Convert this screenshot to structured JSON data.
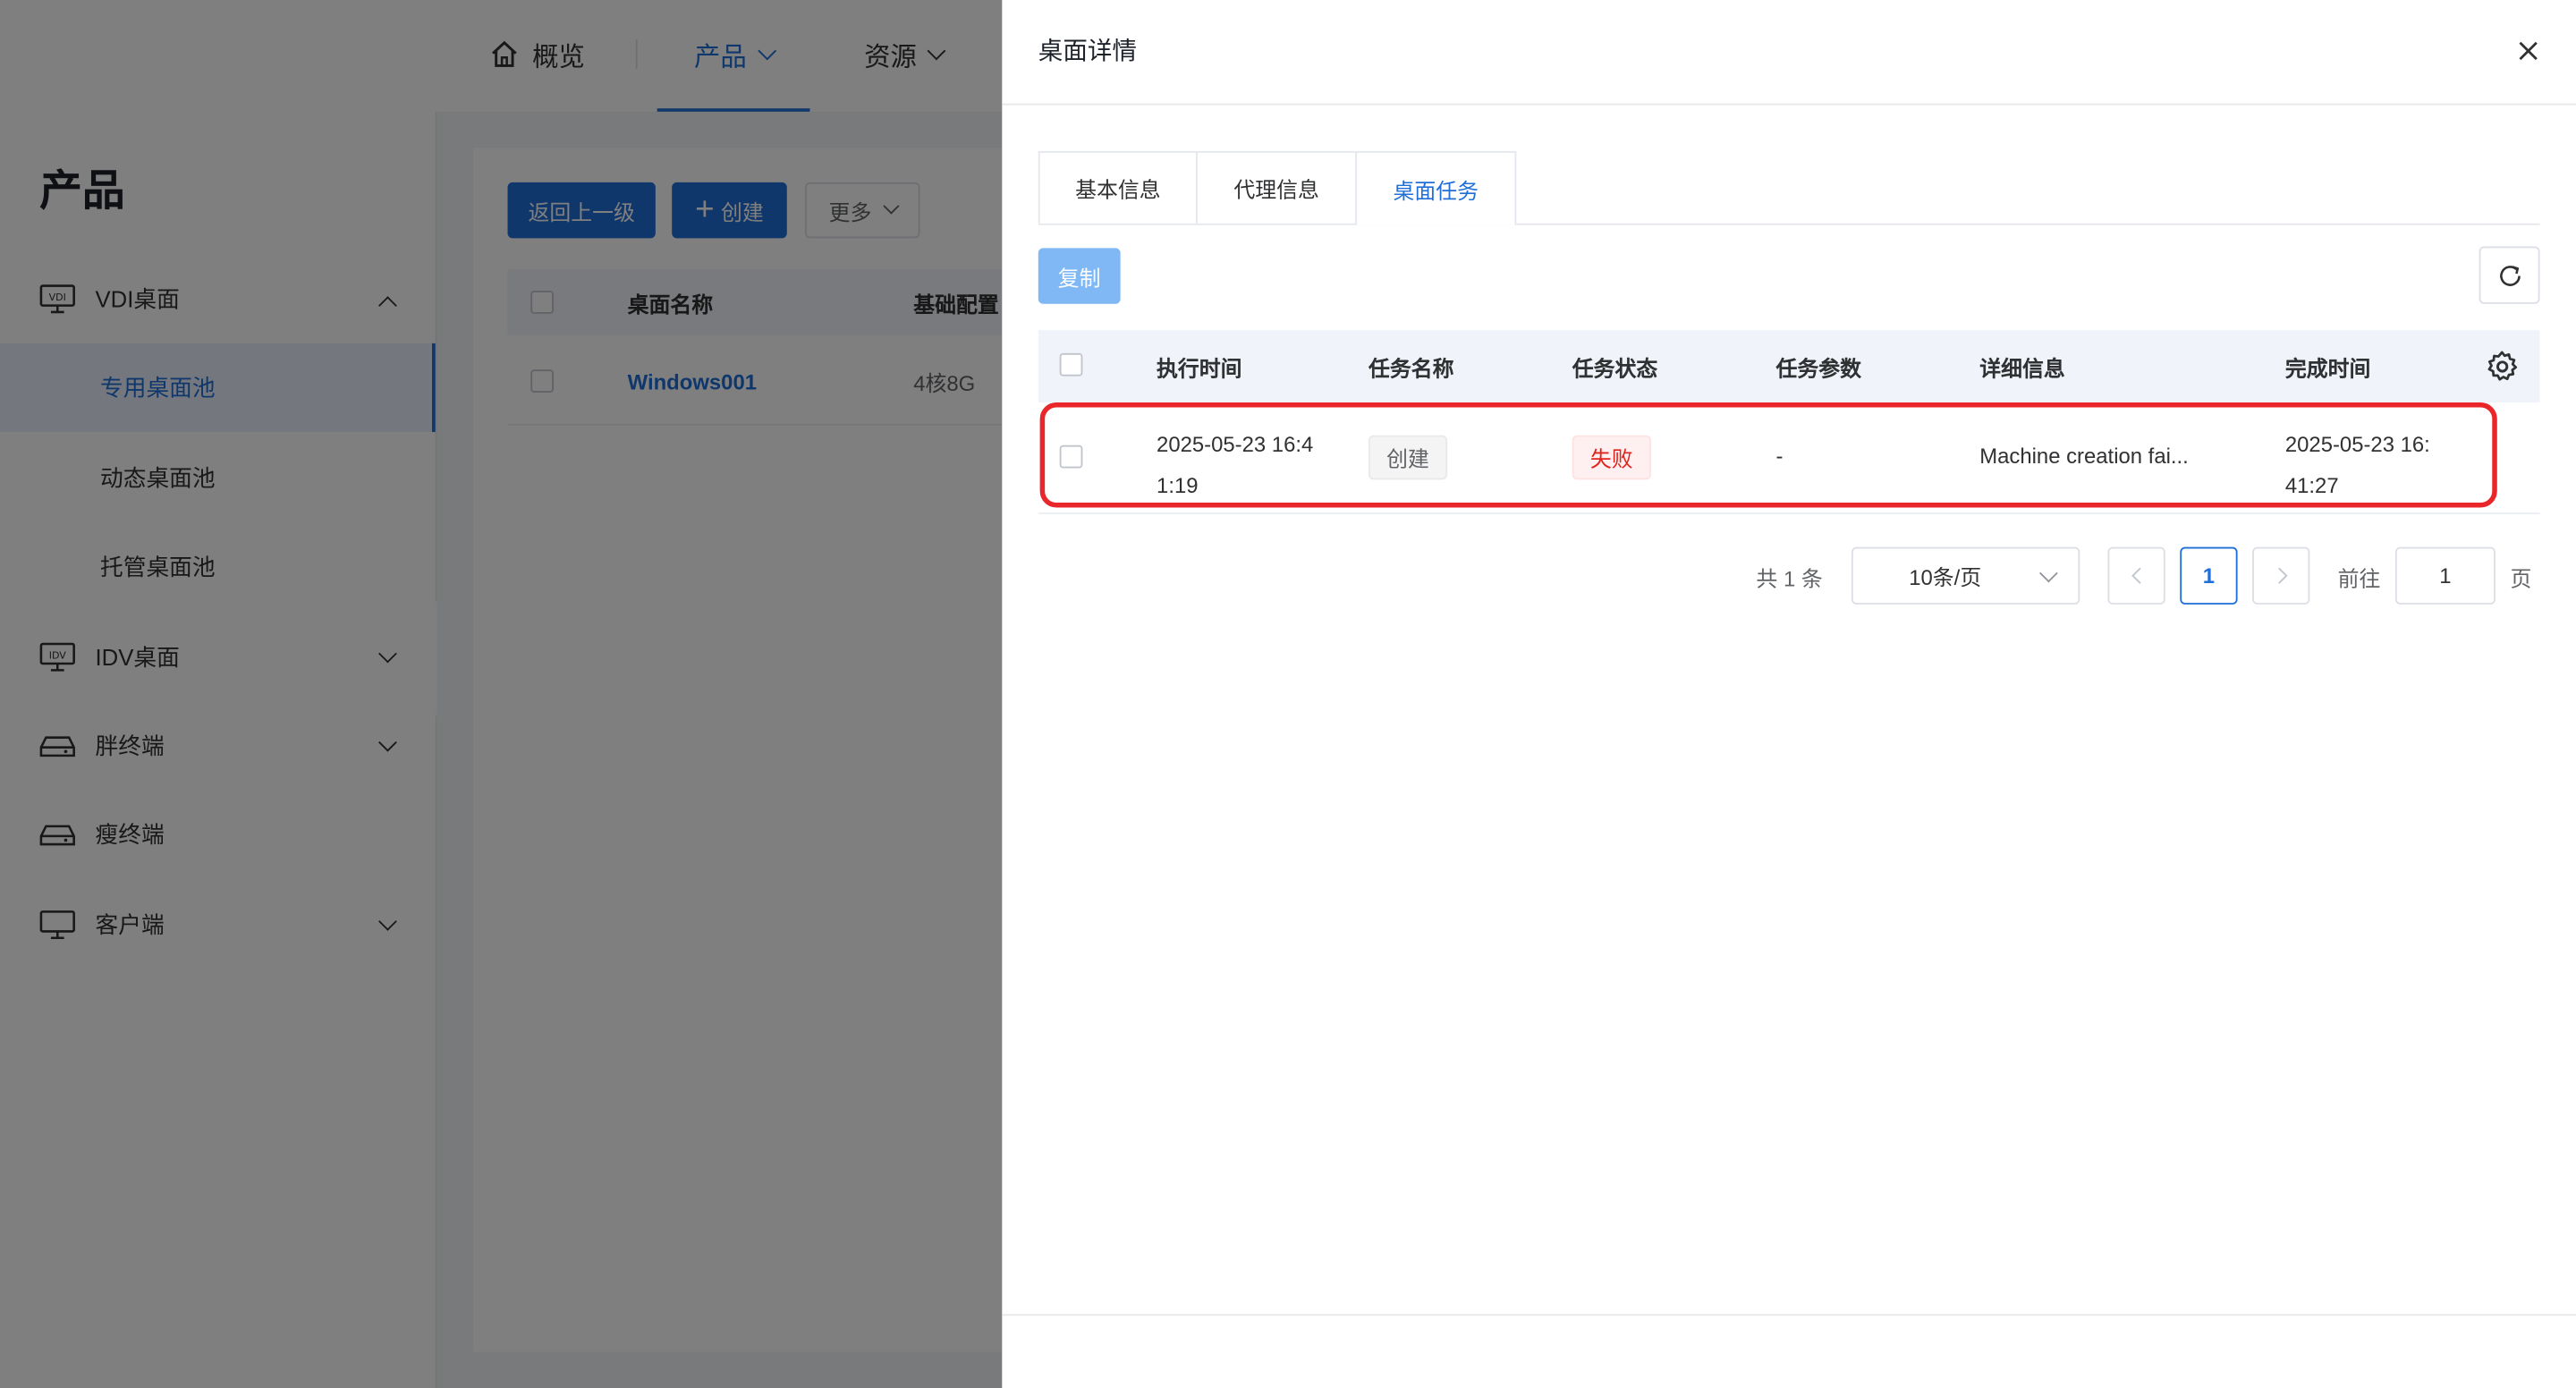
{
  "topnav": {
    "items": [
      {
        "label": "概览",
        "icon": "home-icon"
      },
      {
        "label": "产品",
        "active": true
      },
      {
        "label": "资源"
      }
    ]
  },
  "sidebar": {
    "title": "产品",
    "groups": [
      {
        "label": "VDI桌面",
        "icon": "vdi-monitor-icon",
        "expanded": true,
        "items": [
          {
            "label": "专用桌面池",
            "active": true
          },
          {
            "label": "动态桌面池"
          },
          {
            "label": "托管桌面池"
          }
        ]
      },
      {
        "label": "IDV桌面",
        "icon": "idv-monitor-icon"
      },
      {
        "label": "胖终端",
        "icon": "fat-terminal-icon"
      },
      {
        "label": "瘦终端",
        "icon": "thin-terminal-icon"
      },
      {
        "label": "客户端",
        "icon": "client-monitor-icon"
      }
    ]
  },
  "main": {
    "buttons": {
      "back": "返回上一级",
      "create": "创建",
      "more": "更多"
    },
    "columns": [
      "桌面名称",
      "基础配置"
    ],
    "rows": [
      {
        "name": "Windows001",
        "config": "4核8G"
      }
    ]
  },
  "drawer": {
    "title": "桌面详情",
    "tabs": [
      {
        "label": "基本信息"
      },
      {
        "label": "代理信息"
      },
      {
        "label": "桌面任务",
        "active": true
      }
    ],
    "copy_label": "复制",
    "columns": {
      "exec_time": "执行时间",
      "task_name": "任务名称",
      "task_status": "任务状态",
      "task_params": "任务参数",
      "detail": "详细信息",
      "finish_time": "完成时间"
    },
    "rows": [
      {
        "exec_time_1": "2025-05-23 16:4",
        "exec_time_2": "1:19",
        "task_name": "创建",
        "task_status": "失败",
        "task_params": "-",
        "detail": "Machine creation fai...",
        "finish_time_1": "2025-05-23 16:",
        "finish_time_2": "41:27"
      }
    ],
    "pagination": {
      "total_text": "共 1 条",
      "page_size": "10条/页",
      "current_page": "1",
      "goto_label": "前往",
      "goto_value": "1",
      "page_unit": "页"
    }
  },
  "colors": {
    "primary": "#1f6fd6",
    "danger": "#e0241b",
    "highlight_border": "#e9262a",
    "copy_disabled": "#7fb8f5"
  }
}
